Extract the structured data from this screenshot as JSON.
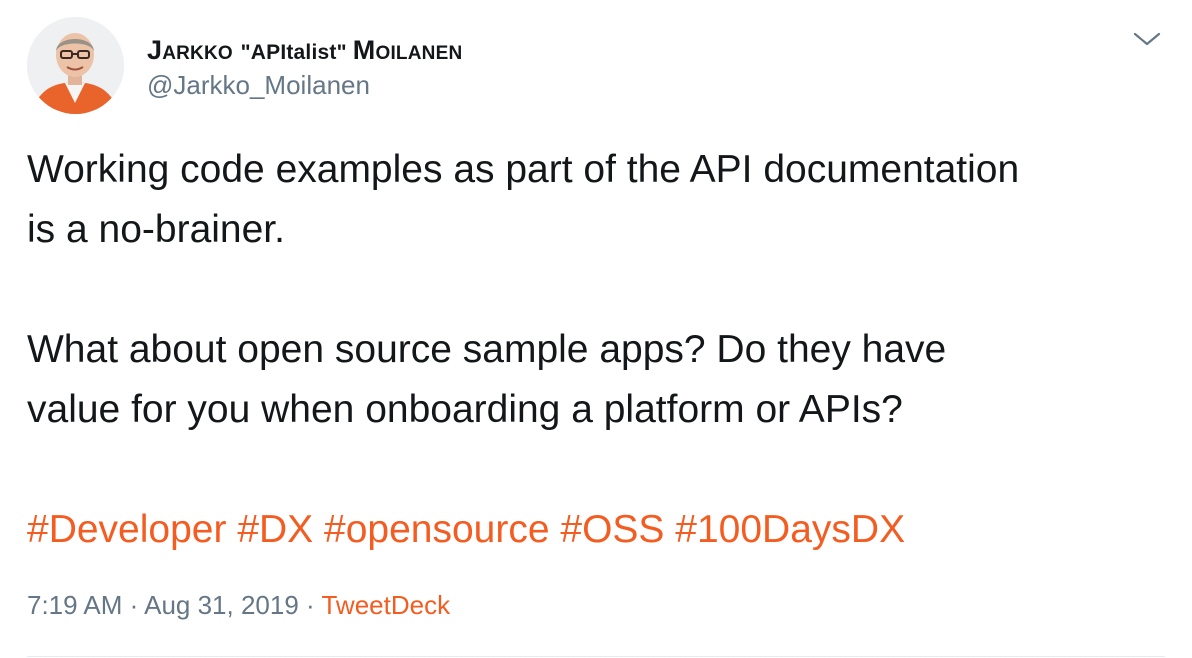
{
  "author": {
    "name_initial_1": "J",
    "name_part_1": "arkko ",
    "name_nick": "\"APItalist\" ",
    "name_initial_2": "M",
    "name_part_2": "oilanen",
    "handle": "@Jarkko_Moilanen"
  },
  "menu": {
    "icon": "chevron-down-icon"
  },
  "tweet": {
    "paragraph_1_line_1": "Working code examples as part of the API documentation",
    "paragraph_1_line_2": "is a no-brainer.",
    "paragraph_2_line_1": "What about open source sample apps? Do they have",
    "paragraph_2_line_2": "value for you when onboarding a platform or APIs?",
    "hashtags": [
      "#Developer",
      "#DX",
      "#opensource",
      "#OSS",
      "#100DaysDX"
    ]
  },
  "meta": {
    "time": "7:19 AM",
    "separator": "·",
    "date": "Aug 31, 2019",
    "source": "TweetDeck"
  },
  "colors": {
    "link": "#f45d22",
    "text": "#14171a",
    "secondary": "#657786",
    "divider": "#e6ecf0"
  }
}
